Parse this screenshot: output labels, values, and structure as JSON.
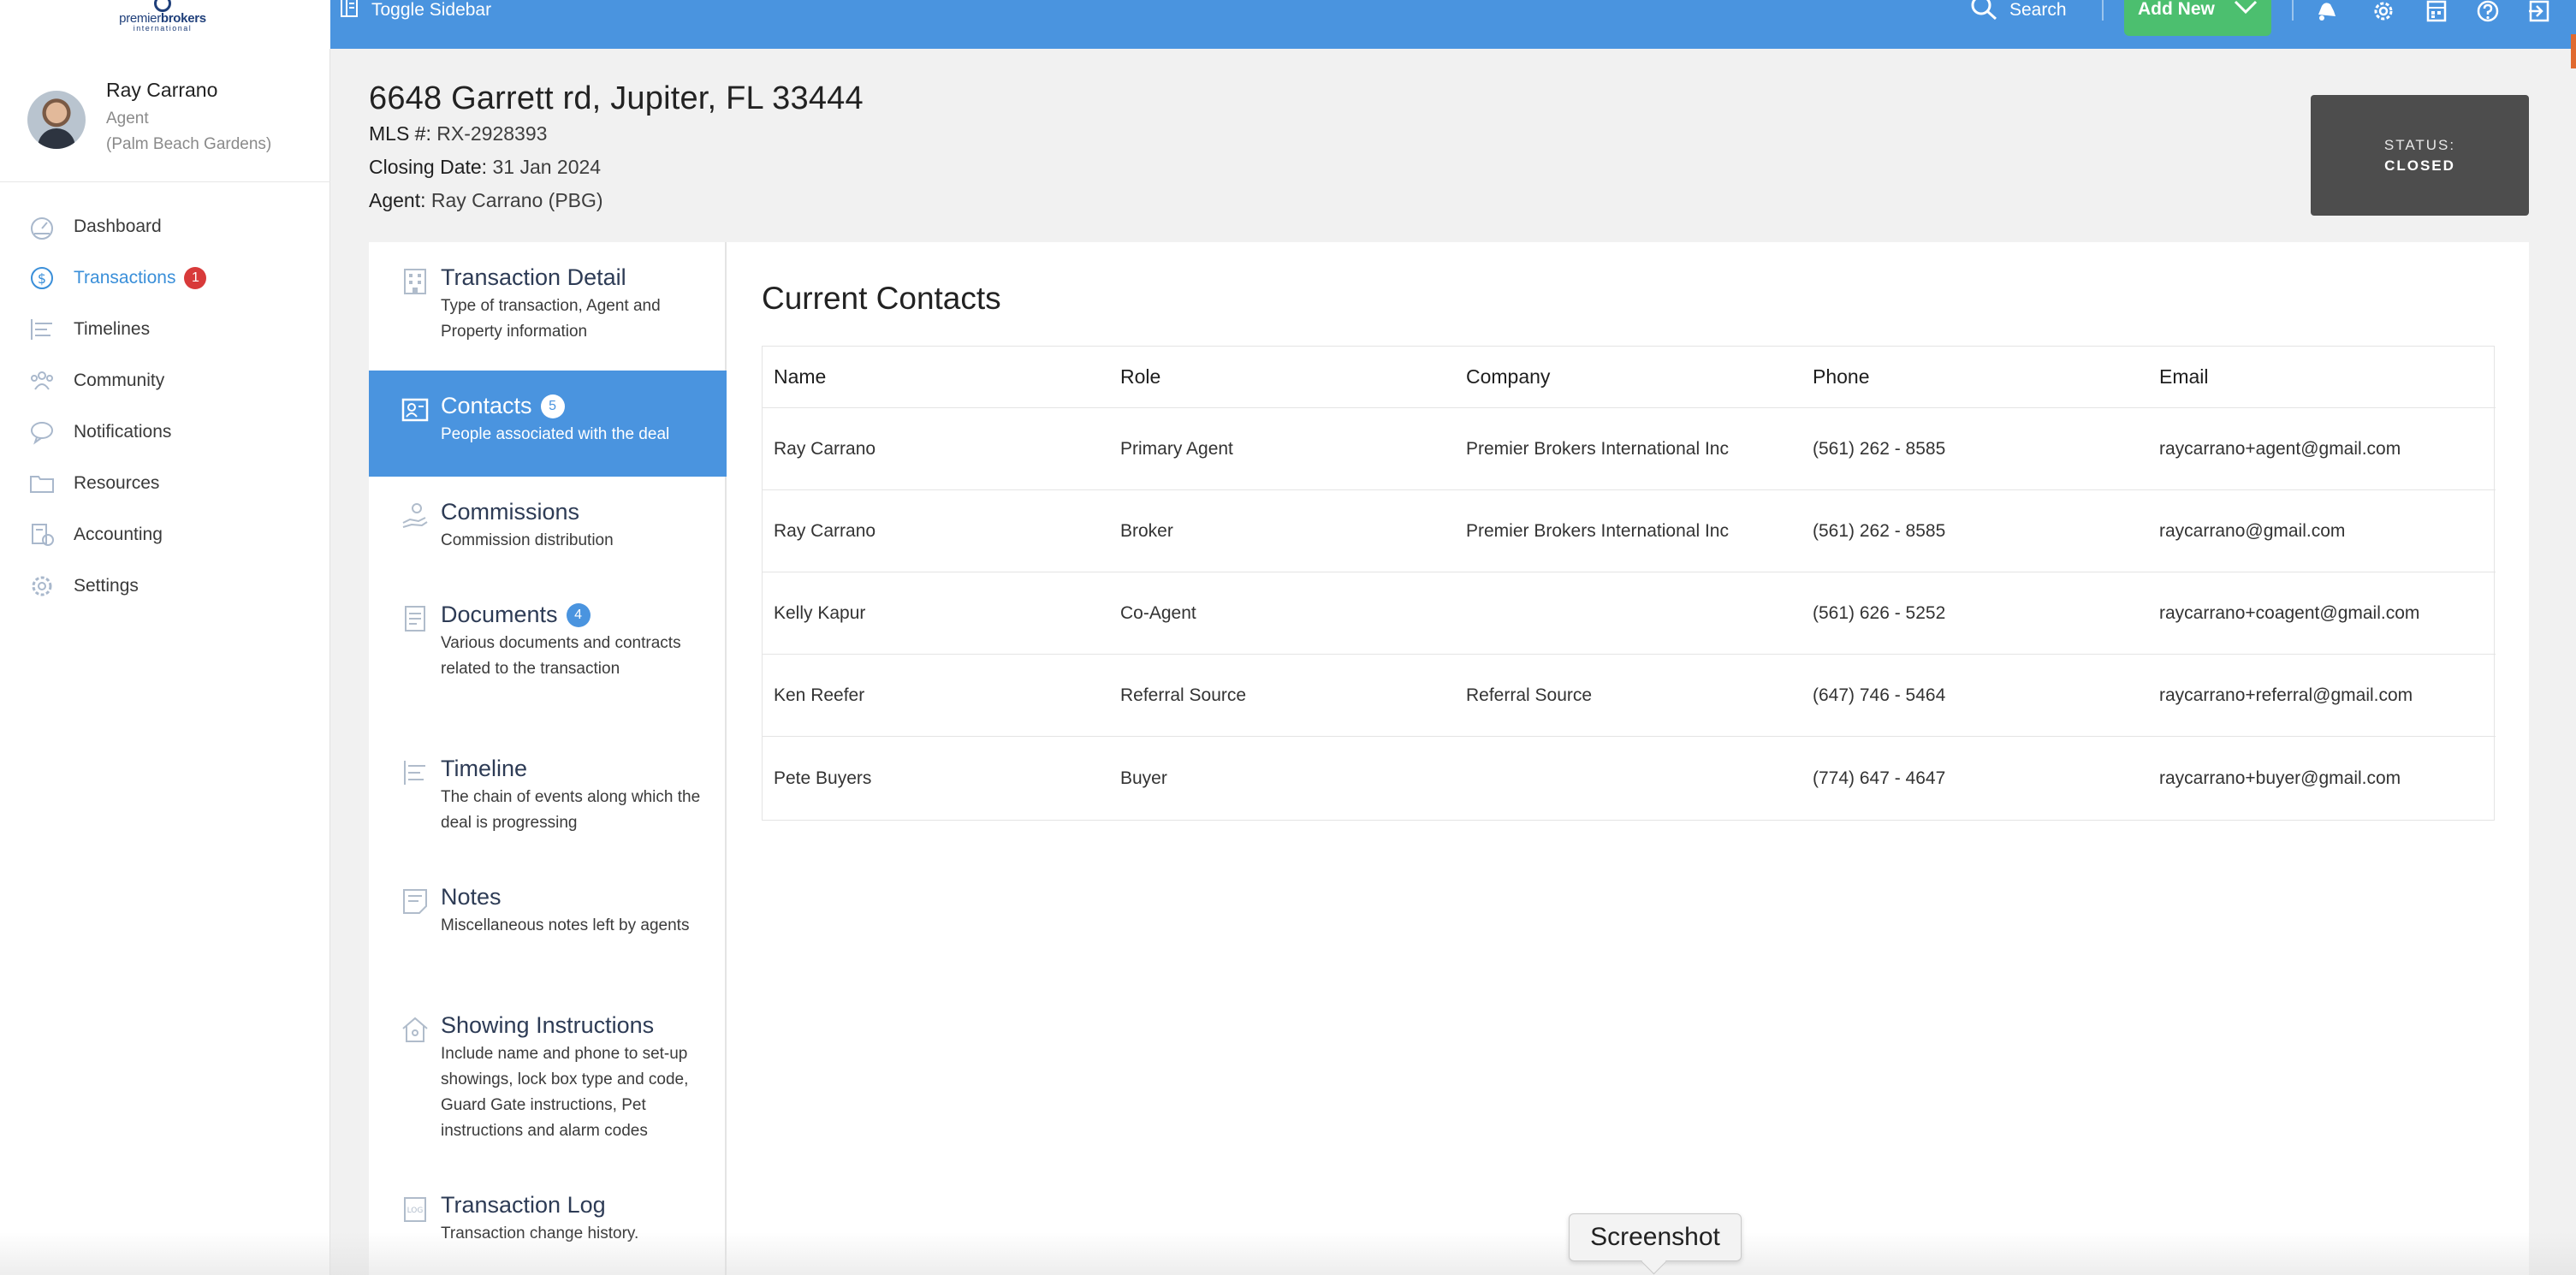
{
  "topbar": {
    "logo_line1_a": "premier",
    "logo_line1_b": "brokers",
    "logo_line2": "international",
    "toggle_sidebar_label": "Toggle Sidebar",
    "search_label": "Search",
    "add_new_label": "Add New",
    "accent_color": "#4a94df",
    "add_new_color": "#4cbf6f"
  },
  "user": {
    "name": "Ray Carrano",
    "role": "Agent",
    "office": "(Palm Beach Gardens)"
  },
  "sidebar": {
    "items": [
      {
        "label": "Dashboard",
        "icon": "dashboard-icon"
      },
      {
        "label": "Transactions",
        "icon": "dollar-icon",
        "badge": "1",
        "active": true
      },
      {
        "label": "Timelines",
        "icon": "timeline-icon"
      },
      {
        "label": "Community",
        "icon": "community-icon"
      },
      {
        "label": "Notifications",
        "icon": "chat-icon"
      },
      {
        "label": "Resources",
        "icon": "folder-icon"
      },
      {
        "label": "Accounting",
        "icon": "accounting-icon"
      },
      {
        "label": "Settings",
        "icon": "gear-icon"
      }
    ]
  },
  "transaction": {
    "address": "6648 Garrett rd, Jupiter, FL 33444",
    "mls_key": "MLS #:",
    "mls_value": "RX-2928393",
    "closing_key": "Closing Date:",
    "closing_value": "31 Jan 2024",
    "agent_key": "Agent:",
    "agent_value": "Ray Carrano (PBG)",
    "status_label": "STATUS:",
    "status_value": "CLOSED"
  },
  "subnav": {
    "items": [
      {
        "title": "Transaction Detail",
        "desc": "Type of transaction, Agent and Property information",
        "icon": "building-icon"
      },
      {
        "title": "Contacts",
        "badge": "5",
        "desc": "People associated with the deal",
        "icon": "contacts-icon",
        "active": true
      },
      {
        "title": "Commissions",
        "desc": "Commission distribution",
        "icon": "hand-coin-icon"
      },
      {
        "title": "Documents",
        "badge": "4",
        "desc": "Various documents and contracts related to the transaction",
        "icon": "document-icon"
      },
      {
        "title": "Timeline",
        "desc": "The chain of events along which the deal is progressing",
        "icon": "timeline-icon"
      },
      {
        "title": "Notes",
        "desc": "Miscellaneous notes left by agents",
        "icon": "notes-icon"
      },
      {
        "title": "Showing Instructions",
        "desc": "Include name and phone to set-up showings, lock box type and code, Guard Gate instructions, Pet instructions and alarm codes",
        "icon": "house-icon"
      },
      {
        "title": "Transaction Log",
        "desc": "Transaction change history.",
        "icon": "log-icon"
      }
    ]
  },
  "contacts": {
    "title": "Current Contacts",
    "columns": [
      "Name",
      "Role",
      "Company",
      "Phone",
      "Email"
    ],
    "rows": [
      [
        "Ray Carrano",
        "Primary Agent",
        "Premier Brokers International Inc",
        "(561) 262 - 8585",
        "raycarrano+agent@gmail.com"
      ],
      [
        "Ray Carrano",
        "Broker",
        "Premier Brokers International Inc",
        "(561) 262 - 8585",
        "raycarrano@gmail.com"
      ],
      [
        "Kelly Kapur",
        "Co-Agent",
        "",
        "(561) 626 - 5252",
        "raycarrano+coagent@gmail.com"
      ],
      [
        "Ken Reefer",
        "Referral Source",
        "Referral Source",
        "(647) 746 - 5464",
        "raycarrano+referral@gmail.com"
      ],
      [
        "Pete Buyers",
        "Buyer",
        "",
        "(774) 647 - 4647",
        "raycarrano+buyer@gmail.com"
      ]
    ]
  },
  "tooltip": {
    "label": "Screenshot"
  }
}
